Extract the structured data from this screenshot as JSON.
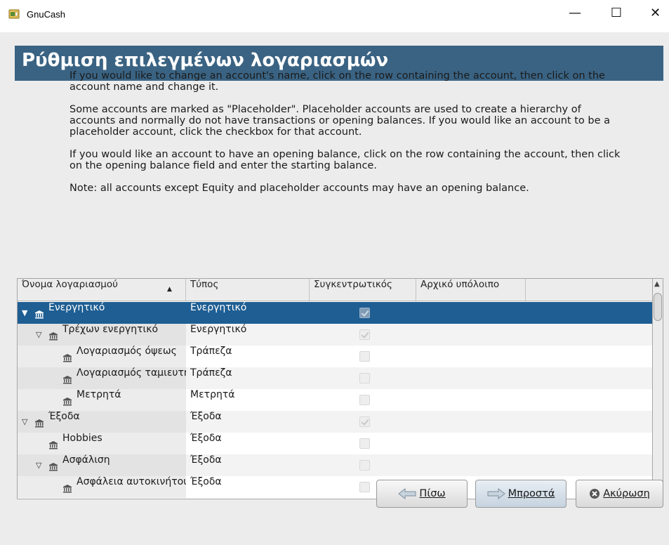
{
  "window": {
    "title": "GnuCash",
    "minimize": "—",
    "maximize": "☐",
    "close": "✕"
  },
  "page": {
    "title": "Ρύθμιση επιλεγμένων λογαριασμών",
    "paragraphs": [
      "If you would like to change an account's name, click on the row containing the account, then click on the account name and change it.",
      "Some accounts are marked as \"Placeholder\". Placeholder accounts are used to create a hierarchy of accounts and normally do not have transactions or opening balances. If you would like an account to be a placeholder account, click the checkbox for that account.",
      "If you would like an account to have an opening balance, click on the row containing the account, then click on the opening balance field and enter the starting balance.",
      "Note: all accounts except Equity and placeholder accounts may have an opening balance."
    ]
  },
  "table": {
    "columns": {
      "name": "Όνομα λογαριασμού",
      "type": "Τύπος",
      "placeholder": "Συγκεντρωτικός",
      "balance": "Αρχικό υπόλοιπο"
    },
    "sort_indicator": "▲",
    "rows": [
      {
        "name": "Ενεργητικό",
        "type": "Ενεργητικό",
        "level": 0,
        "expander": "▼",
        "placeholder": true,
        "selected": true
      },
      {
        "name": "Τρέχων ενεργητικό",
        "type": "Ενεργητικό",
        "level": 1,
        "expander": "▽",
        "placeholder": true,
        "selected": false
      },
      {
        "name": "Λογαριασμός όψεως",
        "type": "Τράπεζα",
        "level": 2,
        "expander": "",
        "placeholder": false,
        "selected": false
      },
      {
        "name": "Λογαριασμός ταμιευτηρίου",
        "type": "Τράπεζα",
        "level": 2,
        "expander": "",
        "placeholder": false,
        "selected": false
      },
      {
        "name": "Μετρητά",
        "type": "Μετρητά",
        "level": 2,
        "expander": "",
        "placeholder": false,
        "selected": false
      },
      {
        "name": "Έξοδα",
        "type": "Έξοδα",
        "level": 0,
        "expander": "▽",
        "placeholder": true,
        "selected": false
      },
      {
        "name": "Hobbies",
        "type": "Έξοδα",
        "level": 1,
        "expander": "",
        "placeholder": false,
        "selected": false
      },
      {
        "name": "Ασφάλιση",
        "type": "Έξοδα",
        "level": 1,
        "expander": "▽",
        "placeholder": false,
        "selected": false
      },
      {
        "name": "Ασφάλεια αυτοκινήτου",
        "type": "Έξοδα",
        "level": 2,
        "expander": "",
        "placeholder": false,
        "selected": false
      }
    ]
  },
  "buttons": {
    "back": "Πίσω",
    "forward": "Μπροστά",
    "cancel": "Ακύρωση"
  },
  "colors": {
    "banner": "#3a6383",
    "selection": "#1e5e93"
  },
  "icons": {
    "app": "gnucash-icon",
    "account": "bank-icon",
    "back": "arrow-left-icon",
    "forward": "arrow-right-icon",
    "cancel": "cancel-icon"
  }
}
